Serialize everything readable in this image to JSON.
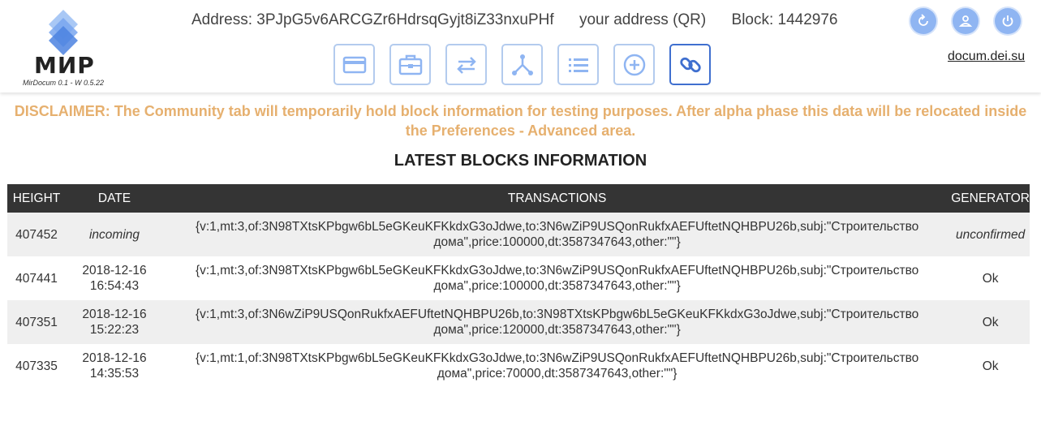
{
  "header": {
    "logo_text": "МИР",
    "version": "MirDocum 0.1 - W 0.5.22",
    "address_label": "Address: 3PJpG5v6ARCGZr6HdrsqGyjt8iZ33nxuPHf",
    "qr_link": "your address (QR)",
    "block_label": "Block: 1442976",
    "site_link": "docum.dei.su"
  },
  "nav": [
    {
      "icon": "card-icon"
    },
    {
      "icon": "briefcase-icon"
    },
    {
      "icon": "transfer-icon"
    },
    {
      "icon": "network-icon"
    },
    {
      "icon": "list-icon"
    },
    {
      "icon": "plus-circle-icon"
    },
    {
      "icon": "link-icon",
      "active": true
    }
  ],
  "round_icons": [
    "refresh-icon",
    "user-icon",
    "power-icon"
  ],
  "disclaimer": "DISCLAIMER: The Community tab will temporarily hold block information for testing purposes. After alpha phase this data will be relocated inside the Preferences - Advanced area.",
  "section_title": "LATEST BLOCKS INFORMATION",
  "table": {
    "headers": {
      "height": "HEIGHT",
      "date": "DATE",
      "transactions": "TRANSACTIONS",
      "generator": "GENERATOR"
    },
    "rows": [
      {
        "height": "407452",
        "date": "incoming",
        "date_time": "",
        "tx": "{v:1,mt:3,of:3N98TXtsKPbgw6bL5eGKeuKFKkdxG3oJdwe,to:3N6wZiP9USQonRukfxAEFUftetNQHBPU26b,subj:\"Строительство дома\",price:100000,dt:3587347643,other:\"\"}",
        "generator": "unconfirmed"
      },
      {
        "height": "407441",
        "date": "2018-12-16",
        "date_time": "16:54:43",
        "tx": "{v:1,mt:3,of:3N98TXtsKPbgw6bL5eGKeuKFKkdxG3oJdwe,to:3N6wZiP9USQonRukfxAEFUftetNQHBPU26b,subj:\"Строительство дома\",price:100000,dt:3587347643,other:\"\"}",
        "generator": "Ok"
      },
      {
        "height": "407351",
        "date": "2018-12-16",
        "date_time": "15:22:23",
        "tx": "{v:1,mt:3,of:3N6wZiP9USQonRukfxAEFUftetNQHBPU26b,to:3N98TXtsKPbgw6bL5eGKeuKFKkdxG3oJdwe,subj:\"Строительство дома\",price:120000,dt:3587347643,other:\"\"}",
        "generator": "Ok"
      },
      {
        "height": "407335",
        "date": "2018-12-16",
        "date_time": "14:35:53",
        "tx": "{v:1,mt:1,of:3N98TXtsKPbgw6bL5eGKeuKFKkdxG3oJdwe,to:3N6wZiP9USQonRukfxAEFUftetNQHBPU26b,subj:\"Строительство дома\",price:70000,dt:3587347643,other:\"\"}",
        "generator": "Ok"
      }
    ]
  },
  "colors": {
    "accent": "#3f6fcf",
    "nav_border": "#b3cbee",
    "disclaimer": "#e6b06f",
    "table_header": "#343434"
  }
}
